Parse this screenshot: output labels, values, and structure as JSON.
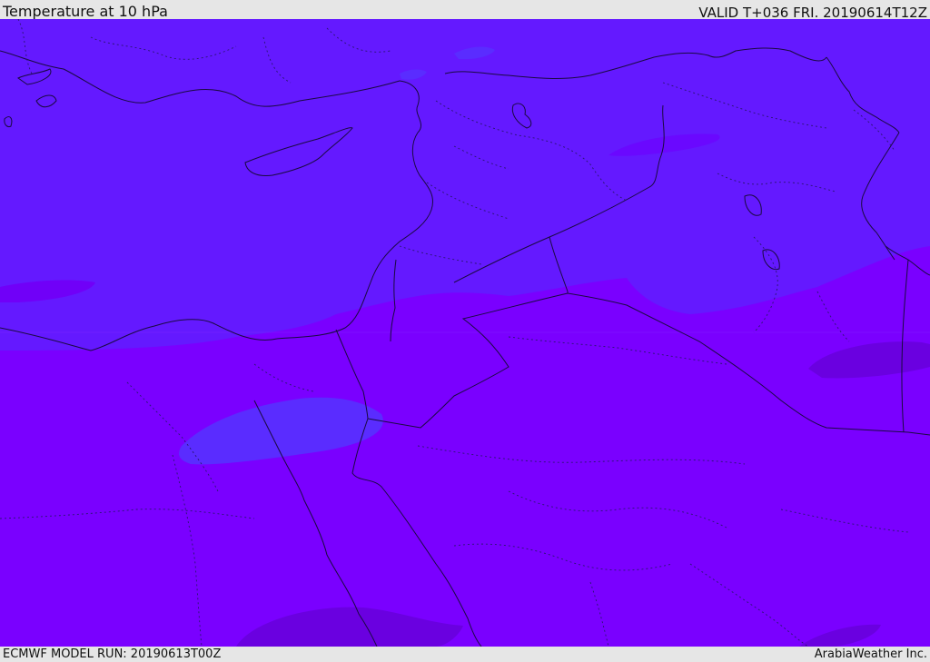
{
  "header": {
    "title": "Temperature at 10 hPa",
    "valid": "VALID T+036 FRI. 20190614T12Z"
  },
  "footer": {
    "model_run": "ECMWF MODEL RUN: 20190613T00Z",
    "credit": "ArabiaWeather Inc."
  },
  "map": {
    "colors": {
      "north_band": "#6419ff",
      "south_band": "#7a00ff",
      "blue_patch": "#5a2cff",
      "darker_patch": "#6a00e8",
      "magenta_patch": "#7300f0",
      "coast": "#1a0a40",
      "border": "#1a0a40"
    }
  }
}
